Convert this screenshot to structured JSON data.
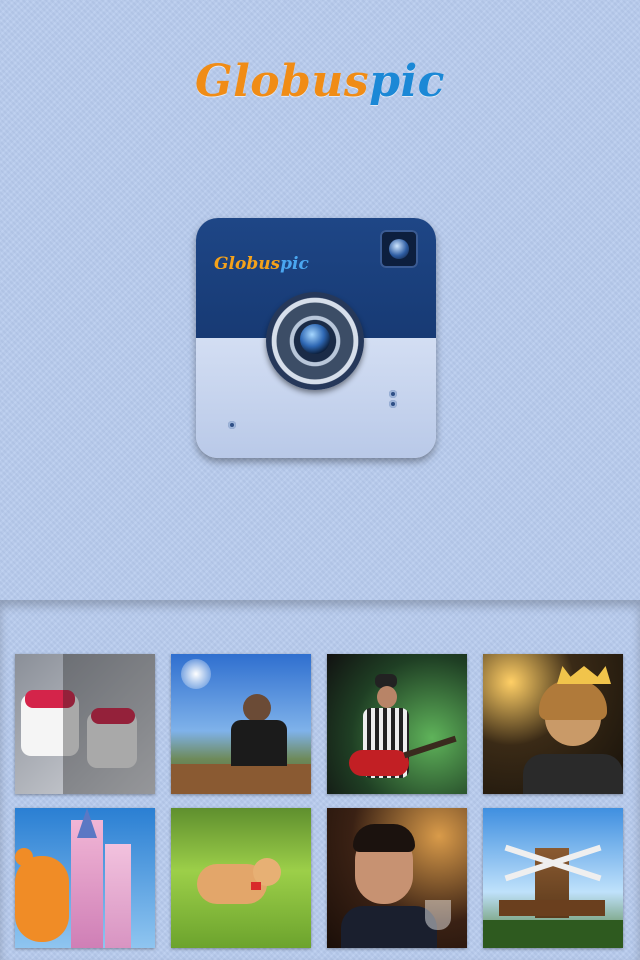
{
  "header": {
    "brand_part1": "Globus",
    "brand_part2": "pic"
  },
  "app_icon": {
    "brand_part1": "Globus",
    "brand_part2": "pic"
  },
  "colors": {
    "background": "#b7cbee",
    "brand_orange": "#f08c16",
    "brand_blue": "#1b88d6",
    "icon_navy": "#1e4686"
  },
  "gallery": {
    "photos": [
      {
        "name": "frozen-yogurt-photo"
      },
      {
        "name": "golden-gate-bench-photo"
      },
      {
        "name": "guitarist-photo"
      },
      {
        "name": "girl-with-crown-photo"
      },
      {
        "name": "castle-photo"
      },
      {
        "name": "cat-on-grass-photo"
      },
      {
        "name": "smiling-man-photo"
      },
      {
        "name": "windmill-photo"
      }
    ]
  }
}
